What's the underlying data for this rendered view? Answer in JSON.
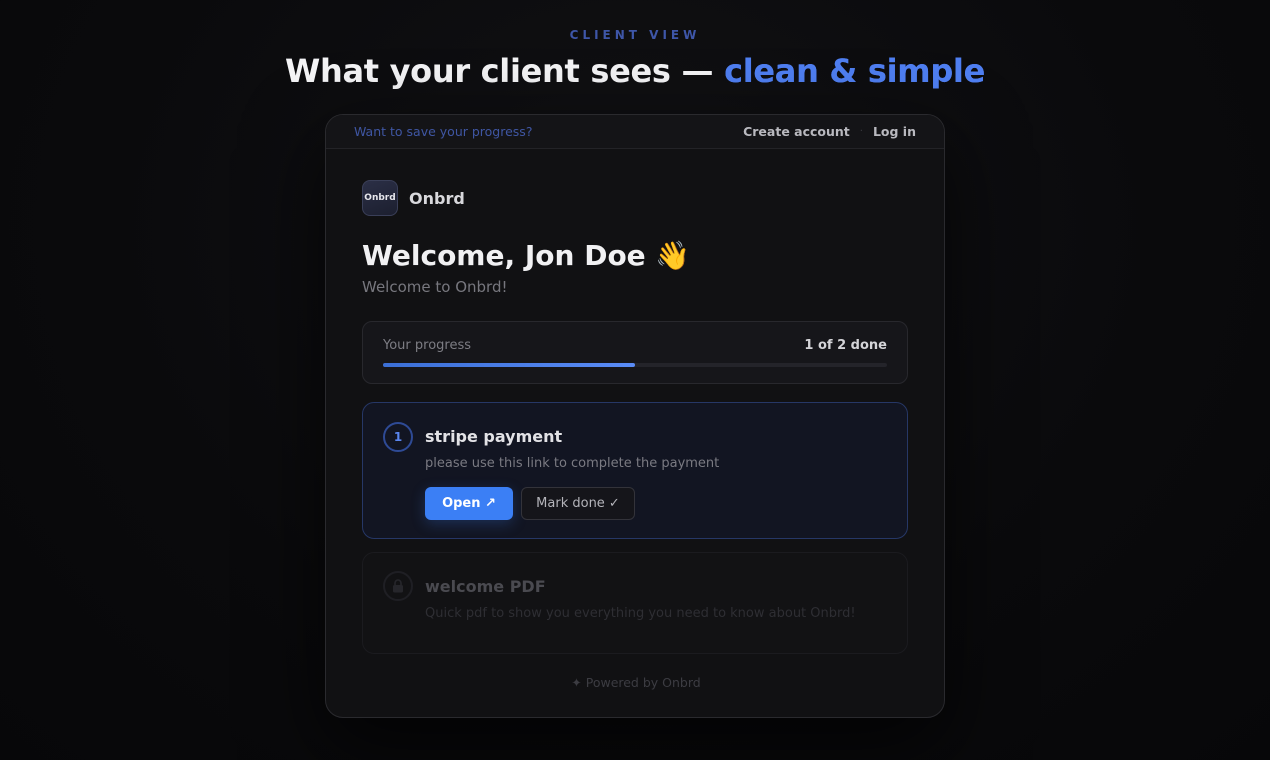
{
  "header": {
    "eyebrow": "CLIENT VIEW",
    "headline_main": "What your client sees —",
    "headline_accent": "clean & simple"
  },
  "topbar": {
    "save_prompt": "Want to save your progress?",
    "create_account": "Create account",
    "separator": "·",
    "login": "Log in"
  },
  "brand": {
    "logo_text": "Onbrd",
    "name": "Onbrd"
  },
  "welcome": {
    "title": "Welcome, Jon Doe 👋",
    "subtitle": "Welcome to Onbrd!"
  },
  "progress": {
    "label": "Your progress",
    "count": "1 of 2 done",
    "fraction": 0.5
  },
  "steps": [
    {
      "number": "1",
      "title": "stripe payment",
      "description": "please use this link to complete the payment",
      "open_label": "Open ↗",
      "mark_done_label": "Mark done ✓",
      "state": "active"
    },
    {
      "icon": "lock-icon",
      "title": "welcome PDF",
      "description": "Quick pdf to show you everything you need to know about Onbrd!",
      "state": "locked"
    }
  ],
  "footer": {
    "text": "✦ Powered by Onbrd"
  },
  "colors": {
    "accent": "#3b7ff5",
    "background": "#0a0a0c",
    "card": "#111113"
  }
}
